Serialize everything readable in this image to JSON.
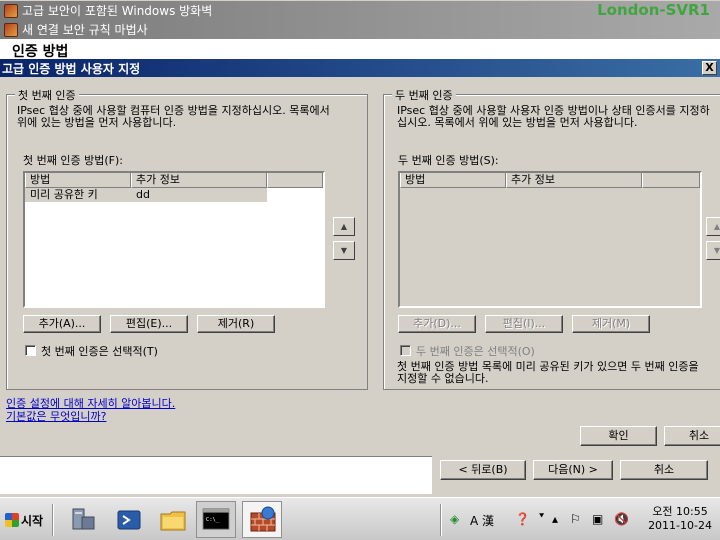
{
  "window": {
    "title1": "고급 보안이 포함된 Windows 방화벽",
    "title2": "새 연결 보안 규칙 마법사",
    "watermark": "London-SVR1",
    "page_heading": "인증 방법"
  },
  "dialog": {
    "title": "고급 인증 방법 사용자 지정",
    "close_label": "X",
    "first": {
      "legend": "첫 번째 인증",
      "desc_line1": "IPsec 협상 중에 사용할 컴퓨터 인증 방법을 지정하십시오. 목록에서",
      "desc_line2": "위에 있는 방법을 먼저 사용합니다.",
      "list_label": "첫 번째 인증 방법(F):",
      "columns": [
        "방법",
        "추가 정보"
      ],
      "rows": [
        {
          "method": "미리 공유한 키",
          "info": "dd"
        }
      ],
      "add_label": "추가(A)...",
      "edit_label": "편집(E)...",
      "remove_label": "제거(R)",
      "optional_label": "첫 번째 인증은 선택적(T)"
    },
    "second": {
      "legend": "두 번째 인증",
      "desc_line1": "IPsec 협상 중에 사용할 사용자 인증 방법이나 상태 인증서를 지정하",
      "desc_line2": "십시오. 목록에서 위에 있는 방법을 먼저 사용합니다.",
      "list_label": "두 번째 인증 방법(S):",
      "columns": [
        "방법",
        "추가 정보"
      ],
      "add_label": "추가(D)...",
      "edit_label": "편집(I)...",
      "remove_label": "제거(M)",
      "optional_label": "두 번째 인증은 선택적(O)",
      "note_line1": "첫 번째 인증 방법 목록에 미리 공유된 키가 있으면 두 번째 인증을",
      "note_line2": "지정할 수 없습니다."
    },
    "link1": "인증 설정에 대해 자세히 알아봅니다.",
    "link2": "기본값은 무엇입니까?",
    "ok_label": "확인",
    "cancel_label": "취소"
  },
  "wizard_buttons": {
    "back_label": "< 뒤로(B)",
    "next_label": "다음(N) >",
    "cancel_label": "취소"
  },
  "taskbar": {
    "start_label": "시작",
    "ime_label": "A 漢",
    "time": "오전 10:55",
    "date": "2011-10-24"
  }
}
